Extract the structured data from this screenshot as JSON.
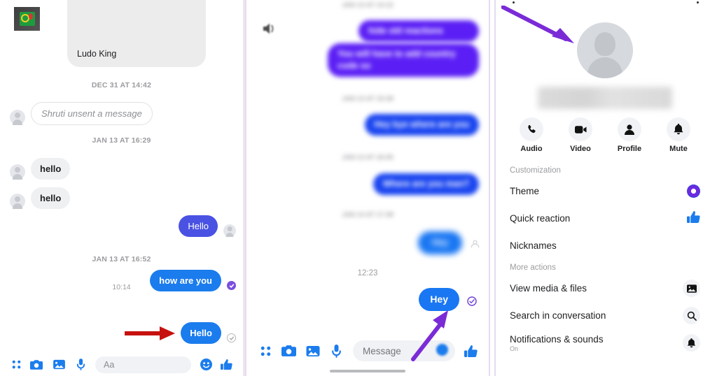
{
  "left_panel": {
    "game_card": {
      "title": "Ludo King",
      "icon": "ludo-king-app-icon"
    },
    "separators": {
      "day1": "DEC 31 AT 14:42",
      "day2": "JAN 13 AT 16:29",
      "day3": "JAN 13 AT 16:52",
      "time1": "10:14"
    },
    "messages": [
      {
        "id": "m1",
        "text": "Shruti unsent a message",
        "side": "incoming",
        "style": "unsent"
      },
      {
        "id": "m2",
        "text": "hello",
        "side": "incoming",
        "style": "grey"
      },
      {
        "id": "m3",
        "text": "hello",
        "side": "incoming",
        "style": "grey"
      },
      {
        "id": "m4",
        "text": "Hello",
        "side": "outgoing",
        "style": "violet",
        "status": "seen-avatar"
      },
      {
        "id": "m5",
        "text": "how are you",
        "side": "outgoing",
        "style": "blue",
        "status": "delivered-filled"
      },
      {
        "id": "m6",
        "text": "Hello",
        "side": "outgoing",
        "style": "blue",
        "status": "sent-hollow"
      }
    ],
    "composer": {
      "placeholder": "Aa",
      "icons": [
        "apps-grid-icon",
        "camera-icon",
        "photo-icon",
        "microphone-icon",
        "emoji-icon",
        "thumbs-up-icon"
      ]
    },
    "annotation": {
      "type": "red-arrow",
      "color": "#c6110f",
      "points_to": "Hello"
    }
  },
  "middle_panel": {
    "separators": {
      "sep1": "JAN 13 AT 14:12",
      "sep2": "JAN 13 AT 15:28",
      "sep3": "JAN 13 AT 16:05",
      "sep4": "JAN 14 AT 17:38",
      "time_last": "12:23"
    },
    "messages": [
      {
        "id": "mm1",
        "text": "hide old reactions",
        "side": "outgoing",
        "style": "violet",
        "blurred": true
      },
      {
        "id": "mm2",
        "text": "You will have to add country code so",
        "side": "outgoing",
        "style": "violet",
        "blurred": true
      },
      {
        "id": "mm3",
        "text": "Hey bye where are you",
        "side": "outgoing",
        "style": "blue",
        "blurred": true
      },
      {
        "id": "mm4",
        "text": "Where are you man?",
        "side": "outgoing",
        "style": "blue",
        "blurred": true
      },
      {
        "id": "mm5",
        "text": "Hey",
        "side": "outgoing",
        "style": "blue2",
        "blurred": true
      },
      {
        "id": "mm6",
        "text": "Hey",
        "side": "outgoing",
        "style": "blue2",
        "blurred": false,
        "status": "delivered-ring"
      }
    ],
    "composer": {
      "placeholder": "Message",
      "icons": [
        "apps-grid-icon",
        "camera-icon",
        "photo-icon",
        "microphone-icon",
        "emoji-icon",
        "thumbs-up-icon"
      ]
    },
    "annotation": {
      "type": "purple-arrow",
      "color": "#7a2bd6",
      "points_to": "message-status-tick"
    }
  },
  "right_panel": {
    "avatar": "default-person-avatar",
    "name_redacted": true,
    "actions": [
      {
        "label": "Audio",
        "icon": "phone-icon"
      },
      {
        "label": "Video",
        "icon": "video-camera-icon"
      },
      {
        "label": "Profile",
        "icon": "person-icon"
      },
      {
        "label": "Mute",
        "icon": "bell-icon"
      }
    ],
    "sections": [
      {
        "title": "Customization",
        "items": [
          {
            "label": "Theme",
            "icon": "theme-color-dot-icon",
            "sub": ""
          },
          {
            "label": "Quick reaction",
            "icon": "thumbs-up-icon",
            "sub": ""
          },
          {
            "label": "Nicknames",
            "icon": "",
            "sub": ""
          }
        ]
      },
      {
        "title": "More actions",
        "items": [
          {
            "label": "View media & files",
            "icon": "photo-icon",
            "sub": ""
          },
          {
            "label": "Search in conversation",
            "icon": "search-icon",
            "sub": ""
          },
          {
            "label": "Notifications & sounds",
            "icon": "bell-icon",
            "sub": "On"
          }
        ]
      }
    ],
    "annotation": {
      "type": "purple-arrow",
      "color": "#7a2bd6",
      "points_to": "profile-avatar"
    }
  },
  "colors": {
    "messenger_blue": "#1b7ced",
    "messenger_violet": "#4a52e3",
    "deep_violet": "#5b1ff5",
    "tick_purple": "#7a4ee0",
    "red_annotation": "#c6110f",
    "purple_annotation": "#7a2bd6",
    "panel_border": "#e6dcf0",
    "bubble_grey": "#eef0f2"
  }
}
